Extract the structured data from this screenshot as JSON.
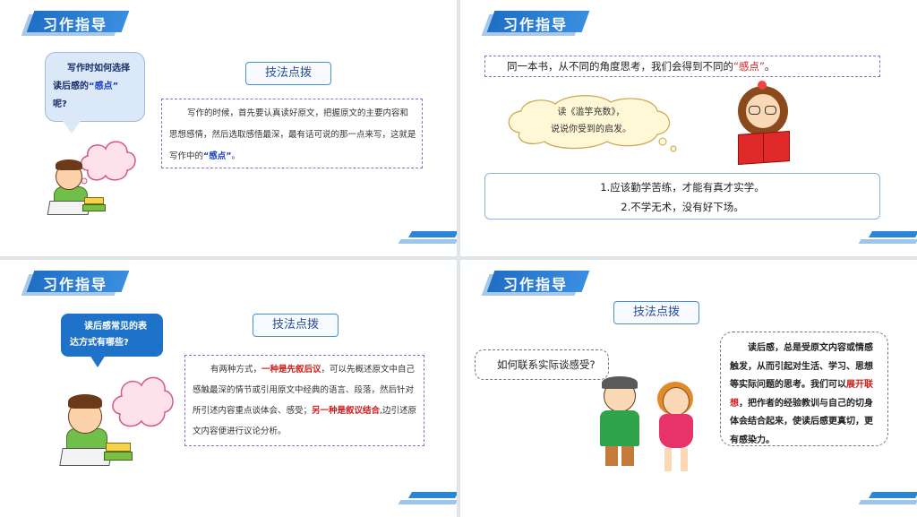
{
  "banner_title": "习作指导",
  "panel1": {
    "question": {
      "line1": "写作时如何选择",
      "line2_pre": "读后感的",
      "line2_em": "“感点”",
      "line3": "呢?"
    },
    "tip_label": "技法点拨",
    "paragraph": {
      "text_pre": "写作的时候，首先要认真读好原文，把握原文的主要内容和思想感情，然后选取感悟最深，最有话可说的那一点来写，这就是写作中的",
      "text_em": "“感点”",
      "text_post": "。"
    }
  },
  "panel2": {
    "heading_pre": "同一本书，从不同的角度思考，我们会得到不同的",
    "heading_em": "“感点”",
    "heading_post": "。",
    "thought_line1": "读《滥竽充数》，",
    "thought_line2": "说说你受到的启发。",
    "answers": [
      "1.应该勤学苦练，才能有真才实学。",
      "2.不学无术，没有好下场。"
    ]
  },
  "panel3": {
    "question_line1": "读后感常见的表",
    "question_line2": "达方式有哪些?",
    "tip_label": "技法点拨",
    "paragraph": {
      "p1": "有两种方式，",
      "em1": "一种是先叙后议",
      "p2": "，可以先概述原文中自己感触最深的情节或引用原文中经典的语言、段落，然后针对所引述内容重点谈体会、感受；",
      "em2": "另一种是叙议结合",
      "p3": ",边引述原文内容便进行议论分析。"
    }
  },
  "panel4": {
    "tip_label": "技法点拨",
    "question": "如何联系实际谈感受?",
    "paragraph": {
      "p1": "读后感，总是受原文内容或情感触发，从而引起对生活、学习、思想等实际问题的思考。我们可以",
      "em": "展开联想",
      "p2": "，把作者的经验教训与自己的切身体会结合起来，使读后感更真切，更有感染力。"
    }
  },
  "colors": {
    "banner_blue": "#1f6fc4",
    "emphasis_red": "#d02020",
    "emphasis_blue": "#1a3fc2",
    "tip_border": "#4a8fd4"
  }
}
